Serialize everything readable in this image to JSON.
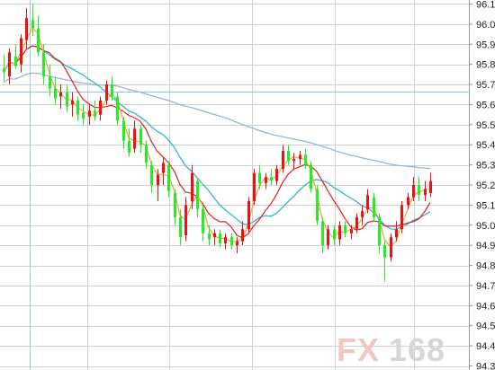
{
  "chart_data": {
    "type": "candlestick",
    "y_ticks": [
      "96.1",
      "96.0",
      "95.9",
      "95.8",
      "95.7",
      "95.6",
      "95.5",
      "95.4",
      "95.3",
      "95.2",
      "95.1",
      "95.0",
      "94.9",
      "94.8",
      "94.7",
      "94.6",
      "94.5",
      "94.4",
      "94.3"
    ],
    "y_tick_values": [
      96.1,
      96.0,
      95.9,
      95.8,
      95.7,
      95.6,
      95.5,
      95.4,
      95.3,
      95.2,
      95.1,
      95.0,
      94.9,
      94.8,
      94.7,
      94.6,
      94.5,
      94.4,
      94.3
    ],
    "ylim": [
      94.3,
      96.15
    ],
    "grid": true,
    "colors": {
      "up": "#ee1111",
      "down": "#22ee22",
      "ma_fast": "#f0a040",
      "ma_mid": "#e02020",
      "ma_slow": "#20b8c0",
      "ma_long": "#8fb0e0",
      "grid": "#d0d0d0",
      "vline": "#8cd0e8"
    },
    "candles": [
      [
        95.78,
        95.85,
        95.72,
        95.76
      ],
      [
        95.74,
        95.88,
        95.7,
        95.86
      ],
      [
        95.84,
        95.9,
        95.78,
        95.79
      ],
      [
        95.8,
        95.95,
        95.76,
        95.93
      ],
      [
        95.92,
        96.08,
        95.88,
        96.03
      ],
      [
        96.02,
        96.1,
        95.94,
        95.98
      ],
      [
        95.98,
        96.04,
        95.84,
        95.86
      ],
      [
        95.86,
        95.9,
        95.7,
        95.74
      ],
      [
        95.74,
        95.8,
        95.64,
        95.68
      ],
      [
        95.68,
        95.74,
        95.6,
        95.63
      ],
      [
        95.64,
        95.7,
        95.58,
        95.66
      ],
      [
        95.66,
        95.7,
        95.56,
        95.59
      ],
      [
        95.6,
        95.66,
        95.54,
        95.62
      ],
      [
        95.62,
        95.64,
        95.52,
        95.55
      ],
      [
        95.56,
        95.6,
        95.5,
        95.53
      ],
      [
        95.54,
        95.6,
        95.5,
        95.57
      ],
      [
        95.57,
        95.62,
        95.52,
        95.54
      ],
      [
        95.55,
        95.64,
        95.52,
        95.62
      ],
      [
        95.62,
        95.72,
        95.6,
        95.7
      ],
      [
        95.7,
        95.74,
        95.62,
        95.64
      ],
      [
        95.64,
        95.66,
        95.5,
        95.52
      ],
      [
        95.52,
        95.54,
        95.38,
        95.42
      ],
      [
        95.42,
        95.48,
        95.34,
        95.36
      ],
      [
        95.38,
        95.52,
        95.36,
        95.48
      ],
      [
        95.48,
        95.5,
        95.36,
        95.4
      ],
      [
        95.4,
        95.42,
        95.28,
        95.31
      ],
      [
        95.3,
        95.32,
        95.16,
        95.2
      ],
      [
        95.2,
        95.28,
        95.12,
        95.25
      ],
      [
        95.26,
        95.34,
        95.2,
        95.31
      ],
      [
        95.3,
        95.32,
        95.14,
        95.17
      ],
      [
        95.16,
        95.18,
        95.0,
        95.04
      ],
      [
        95.04,
        95.08,
        94.9,
        94.94
      ],
      [
        94.95,
        95.14,
        94.92,
        95.1
      ],
      [
        95.12,
        95.3,
        95.08,
        95.26
      ],
      [
        95.22,
        95.24,
        95.04,
        95.08
      ],
      [
        95.08,
        95.1,
        94.92,
        94.96
      ],
      [
        94.96,
        95.0,
        94.9,
        94.93
      ],
      [
        94.94,
        94.98,
        94.9,
        94.96
      ],
      [
        94.96,
        94.98,
        94.89,
        94.91
      ],
      [
        94.91,
        94.96,
        94.88,
        94.94
      ],
      [
        94.94,
        94.96,
        94.88,
        94.9
      ],
      [
        94.9,
        94.94,
        94.86,
        94.92
      ],
      [
        94.92,
        95.02,
        94.9,
        94.98
      ],
      [
        94.98,
        95.14,
        94.96,
        95.12
      ],
      [
        95.12,
        95.28,
        95.1,
        95.26
      ],
      [
        95.26,
        95.3,
        95.18,
        95.21
      ],
      [
        95.21,
        95.26,
        95.18,
        95.24
      ],
      [
        95.24,
        95.28,
        95.2,
        95.22
      ],
      [
        95.22,
        95.3,
        95.2,
        95.28
      ],
      [
        95.28,
        95.4,
        95.26,
        95.37
      ],
      [
        95.37,
        95.4,
        95.3,
        95.32
      ],
      [
        95.32,
        95.36,
        95.28,
        95.33
      ],
      [
        95.33,
        95.37,
        95.3,
        95.35
      ],
      [
        95.35,
        95.38,
        95.28,
        95.3
      ],
      [
        95.3,
        95.32,
        95.16,
        95.18
      ],
      [
        95.18,
        95.2,
        95.0,
        95.02
      ],
      [
        95.02,
        95.04,
        94.86,
        94.9
      ],
      [
        94.9,
        95.0,
        94.88,
        94.98
      ],
      [
        94.98,
        95.0,
        94.9,
        94.93
      ],
      [
        94.93,
        95.02,
        94.9,
        95.0
      ],
      [
        95.0,
        95.02,
        94.94,
        94.96
      ],
      [
        94.96,
        95.0,
        94.93,
        94.98
      ],
      [
        94.98,
        95.06,
        94.96,
        95.04
      ],
      [
        95.04,
        95.1,
        95.0,
        95.07
      ],
      [
        95.08,
        95.18,
        95.06,
        95.15
      ],
      [
        95.14,
        95.16,
        95.02,
        95.04
      ],
      [
        95.04,
        95.06,
        94.86,
        94.9
      ],
      [
        94.9,
        94.92,
        94.72,
        94.84
      ],
      [
        94.84,
        94.96,
        94.82,
        94.94
      ],
      [
        94.94,
        95.02,
        94.92,
        94.98
      ],
      [
        94.98,
        95.12,
        94.96,
        95.1
      ],
      [
        95.1,
        95.16,
        95.08,
        95.14
      ],
      [
        95.14,
        95.24,
        95.12,
        95.2
      ],
      [
        95.2,
        95.24,
        95.12,
        95.15
      ],
      [
        95.15,
        95.22,
        95.12,
        95.18
      ],
      [
        95.16,
        95.26,
        95.14,
        95.22
      ]
    ]
  },
  "watermark": {
    "fx": "FX",
    "num": "168"
  }
}
